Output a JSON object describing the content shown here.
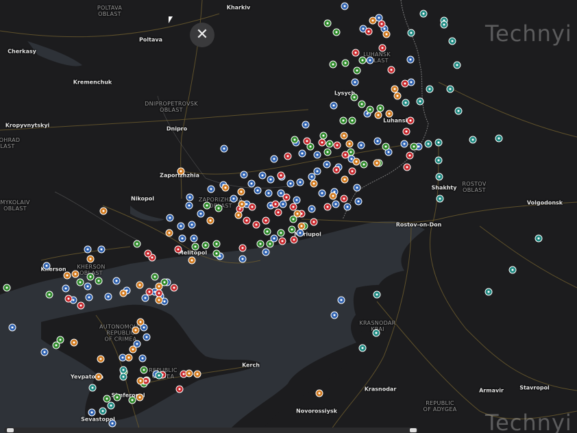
{
  "watermark": "Technyi",
  "close_label": "✕",
  "colors": {
    "blue": "#2f62b0",
    "green": "#2e8a2a",
    "red": "#c8282d",
    "orange": "#d27a1e",
    "teal": "#1f8a82"
  },
  "places": [
    {
      "name": "POLTAVA\nOBLAST",
      "kind": "region"
    },
    {
      "name": "Kharkiv",
      "kind": "city"
    },
    {
      "name": "Poltava",
      "kind": "city"
    },
    {
      "name": "Cherkasy",
      "kind": "city"
    },
    {
      "name": "Kremenchuk",
      "kind": "city"
    },
    {
      "name": "DNIPROPETROVSK\nOBLAST",
      "kind": "region"
    },
    {
      "name": "Dnipro",
      "kind": "city"
    },
    {
      "name": "Kropyvnytskyi",
      "kind": "city"
    },
    {
      "name": "OVOHRAD\nBLAST",
      "kind": "region"
    },
    {
      "name": "LUHANSK\nOBLAST",
      "kind": "region"
    },
    {
      "name": "Lysych",
      "kind": "city"
    },
    {
      "name": "Luhansk",
      "kind": "city"
    },
    {
      "name": "Zaporizhzhia",
      "kind": "city"
    },
    {
      "name": "ZAPORIZHZHIA\nOBLAST",
      "kind": "region"
    },
    {
      "name": "Nikopol",
      "kind": "city"
    },
    {
      "name": "MYKOLAIV\nOBLAST",
      "kind": "region"
    },
    {
      "name": "Shakhty",
      "kind": "city"
    },
    {
      "name": "ROSTOV\nOBLAST",
      "kind": "region"
    },
    {
      "name": "Volgodonsk",
      "kind": "city"
    },
    {
      "name": "Rostov-on-Don",
      "kind": "city"
    },
    {
      "name": "Mariupol",
      "kind": "city"
    },
    {
      "name": "Melitopol",
      "kind": "city"
    },
    {
      "name": "Kherson",
      "kind": "city"
    },
    {
      "name": "KHERSON\nOBLAST",
      "kind": "region"
    },
    {
      "name": "AUTONOMOUS\nREPUBLIC\nOF CRIMEA",
      "kind": "region"
    },
    {
      "name": "REPUBLIC\nCRIMEA",
      "kind": "region"
    },
    {
      "name": "Yevpatoria",
      "kind": "city"
    },
    {
      "name": "Simferopol",
      "kind": "city"
    },
    {
      "name": "Sevastopol",
      "kind": "city"
    },
    {
      "name": "Kerch",
      "kind": "city"
    },
    {
      "name": "KRASNODAR\nKRAI",
      "kind": "region"
    },
    {
      "name": "Krasnodar",
      "kind": "city"
    },
    {
      "name": "Novorossiysk",
      "kind": "city"
    },
    {
      "name": "REPUBLIC\nOF ADYGEA",
      "kind": "region"
    },
    {
      "name": "Armavir",
      "kind": "city"
    },
    {
      "name": "Stavropol",
      "kind": "city"
    }
  ]
}
